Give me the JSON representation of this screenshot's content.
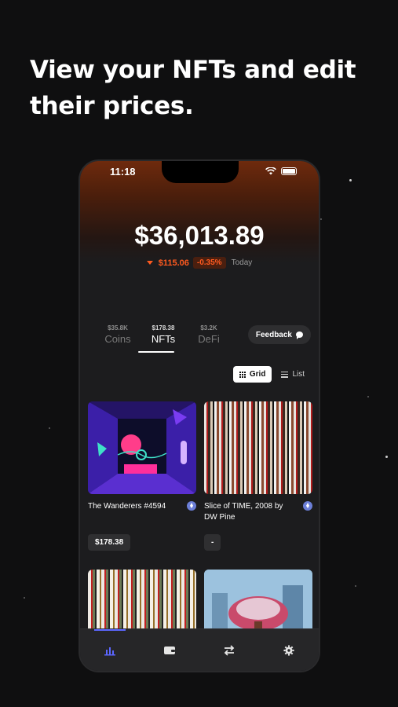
{
  "promo": {
    "headline": "View your NFTs and edit their prices."
  },
  "status_bar": {
    "time": "11:18"
  },
  "portfolio": {
    "balance": "$36,013.89",
    "change_amount": "$115.06",
    "change_percent": "-0.35%",
    "change_period": "Today"
  },
  "tabs": [
    {
      "value": "$35.8K",
      "label": "Coins",
      "active": false
    },
    {
      "value": "$178.38",
      "label": "NFTs",
      "active": true
    },
    {
      "value": "$3.2K",
      "label": "DeFi",
      "active": false
    }
  ],
  "feedback": {
    "label": "Feedback"
  },
  "view_toggle": {
    "grid_label": "Grid",
    "list_label": "List",
    "selected": "Grid"
  },
  "nfts": [
    {
      "name": "The Wanderers #4594",
      "price": "$178.38",
      "chain_icon": "ethereum-icon"
    },
    {
      "name": "Slice of TIME, 2008 by DW Pine",
      "price": "-",
      "chain_icon": "ethereum-icon"
    }
  ],
  "bottom_nav": [
    {
      "icon": "chart-bars-icon",
      "active": true
    },
    {
      "icon": "wallet-icon",
      "active": false
    },
    {
      "icon": "swap-arrows-icon",
      "active": false
    },
    {
      "icon": "gear-icon",
      "active": false
    }
  ],
  "colors": {
    "background": "#0f0f10",
    "accent_negative": "#ff5a1f",
    "nav_active": "#5b66ff",
    "ethereum": "#6c7fd8"
  }
}
